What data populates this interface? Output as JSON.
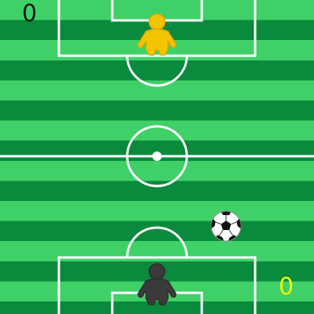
{
  "colors": {
    "stripe_light": "#3fd168",
    "stripe_dark": "#0a8a3c",
    "line": "#ffffff",
    "top_player": "#f5c400",
    "top_player_outline": "#e0a800",
    "bottom_player": "#3a3a3a",
    "top_score": "#1a1a1a",
    "bottom_score": "#f2f200"
  },
  "scoreboard": {
    "top_score": "0",
    "bottom_score": "0"
  },
  "players": {
    "top": {
      "icon": "player-figure-icon",
      "color": "yellow"
    },
    "bottom": {
      "icon": "player-figure-icon",
      "color": "dark-gray"
    }
  },
  "ball": {
    "icon": "soccer-ball-icon"
  }
}
